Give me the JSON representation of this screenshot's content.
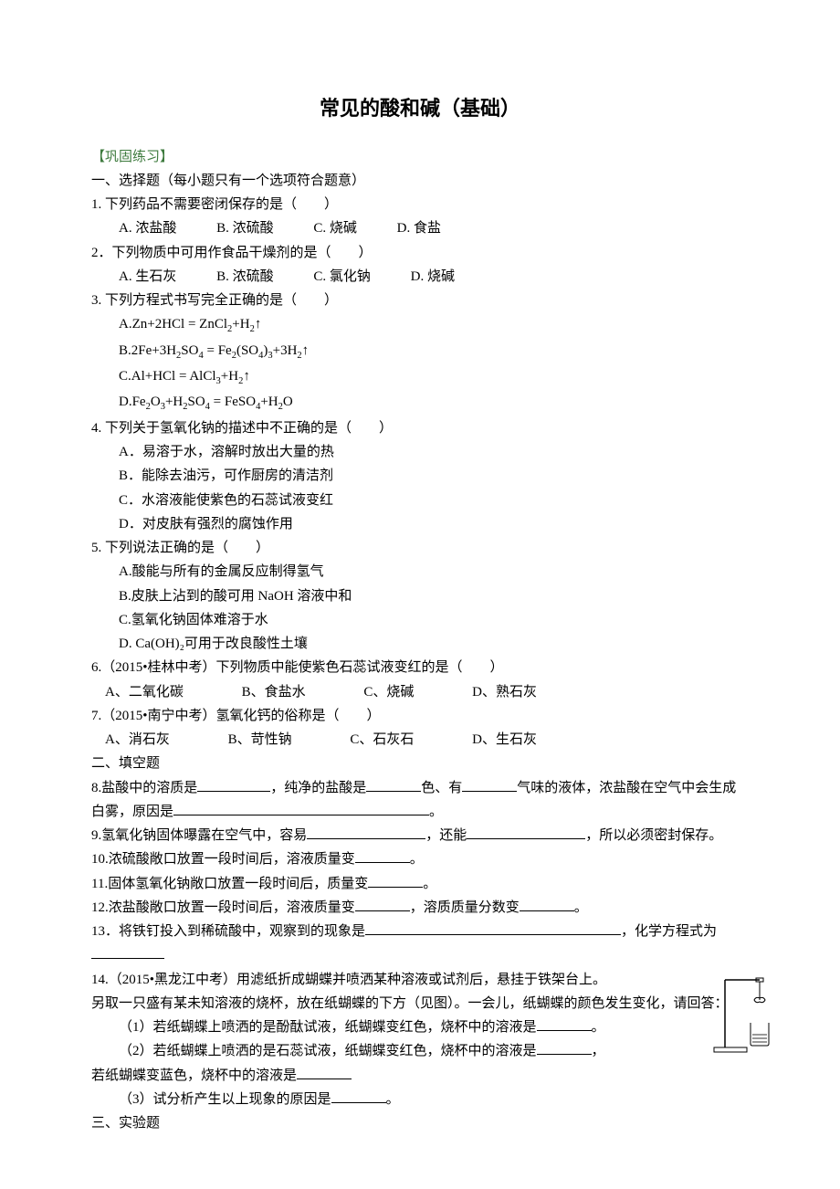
{
  "title": "常见的酸和碱（基础）",
  "section_label": "【巩固练习】",
  "s1_heading": "一、选择题（每小题只有一个选项符合题意）",
  "q1": {
    "stem": "1. 下列药品不需要密闭保存的是（　　）",
    "a": "A. 浓盐酸",
    "b": "B. 浓硫酸",
    "c": "C. 烧碱",
    "d": "D. 食盐"
  },
  "q2": {
    "stem": "2．下列物质中可用作食品干燥剂的是（　　）",
    "a": "A. 生石灰",
    "b": "B. 浓硫酸",
    "c": "C. 氯化钠",
    "d": "D. 烧碱"
  },
  "q3": {
    "stem": "3. 下列方程式书写完全正确的是（　　）"
  },
  "q4": {
    "stem": "4. 下列关于氢氧化钠的描述中不正确的是（　　）",
    "a": "A．易溶于水，溶解时放出大量的热",
    "b": "B．能除去油污，可作厨房的清洁剂",
    "c": "C．水溶液能使紫色的石蕊试液变红",
    "d": "D．对皮肤有强烈的腐蚀作用"
  },
  "q5": {
    "stem": "5. 下列说法正确的是（　　）",
    "a": "A.酸能与所有的金属反应制得氢气",
    "b": "B.皮肤上沾到的酸可用 NaOH 溶液中和",
    "c": "C.氢氧化钠固体难溶于水",
    "d": "D. Ca(OH)₂可用于改良酸性土壤"
  },
  "q6": {
    "stem": "6.（2015•桂林中考）下列物质中能使紫色石蕊试液变红的是（　　）",
    "a": "A、二氧化碳",
    "b": "B、食盐水",
    "c": "C、烧碱",
    "d": "D、熟石灰"
  },
  "q7": {
    "stem": "7.（2015•南宁中考）氢氧化钙的俗称是（　　）",
    "a": "A、消石灰",
    "b": "B、苛性钠",
    "c": "C、石灰石",
    "d": "D、生石灰"
  },
  "s2_heading": "二、填空题",
  "q8_p1": "8.盐酸中的溶质是",
  "q8_p2": "，纯净的盐酸是",
  "q8_p3": "色、有",
  "q8_p4": "气味的液体，浓盐酸在空气中会生成白雾，原因是",
  "q8_p5": "。",
  "q9_p1": "9.氢氧化钠固体曝露在空气中，容易",
  "q9_p2": "，还能",
  "q9_p3": "，所以必须密封保存。",
  "q10_p1": "10.浓硫酸敞口放置一段时间后，溶液质量变",
  "q10_p2": "。",
  "q11_p1": "11.固体氢氧化钠敞口放置一段时间后，质量变",
  "q11_p2": "。",
  "q12_p1": "12.浓盐酸敞口放置一段时间后，溶液质量变",
  "q12_p2": "，溶质质量分数变",
  "q12_p3": "。",
  "q13_p1": "13．将铁钉投入到稀硫酸中，观察到的现象是",
  "q13_p2": "，化学方程式为",
  "q14_intro1": "14.（2015•黑龙江中考）用滤纸折成蝴蝶并喷洒某种溶液或试剂后，悬挂于铁架台上。",
  "q14_intro2": "另取一只盛有某未知溶液的烧杯，放在纸蝴蝶的下方（见图）。一会儿，纸蝴蝶的颜色发生变化，请回答：",
  "q14_sub1_p1": "（1）若纸蝴蝶上喷洒的是酚酞试液，纸蝴蝶变红色，烧杯中的溶液是",
  "q14_sub1_p2": "。",
  "q14_sub2_p1": "（2）若纸蝴蝶上喷洒的是石蕊试液，纸蝴蝶变红色，烧杯中的溶液是",
  "q14_sub2_p2": "，",
  "q14_sub2_p3": "若纸蝴蝶变蓝色，烧杯中的溶液是",
  "q14_sub3_p1": "（3）试分析产生以上现象的原因是",
  "q14_sub3_p2": "。",
  "s3_heading": "三、实验题"
}
